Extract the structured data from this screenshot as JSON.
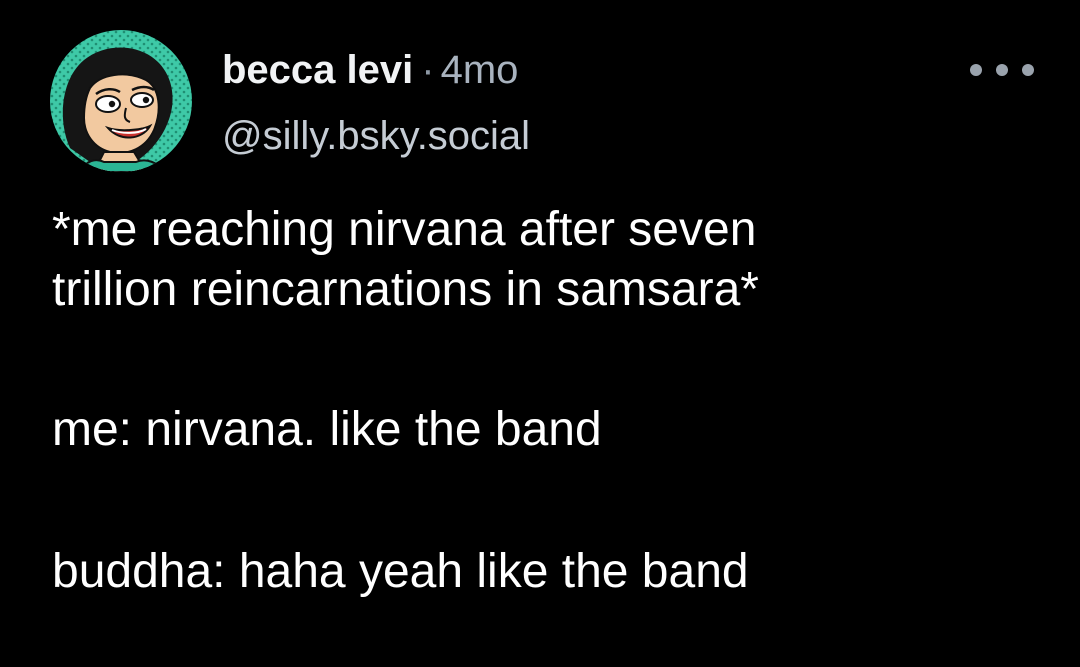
{
  "post": {
    "author": {
      "display_name": "becca levi",
      "separator": "·",
      "time_ago": "4mo",
      "handle": "@silly.bsky.social",
      "avatar": {
        "icon": "cartoon-face-avatar",
        "bg_color": "#3ec9a7",
        "dot_color": "#1f8f73"
      }
    },
    "more_icon": "ellipsis-icon",
    "text": {
      "line1": "*me reaching nirvana after seven",
      "line2": "trillion reincarnations in samsara*",
      "line3": "me: nirvana. like the band",
      "line4": "buddha: haha yeah like the band"
    }
  }
}
